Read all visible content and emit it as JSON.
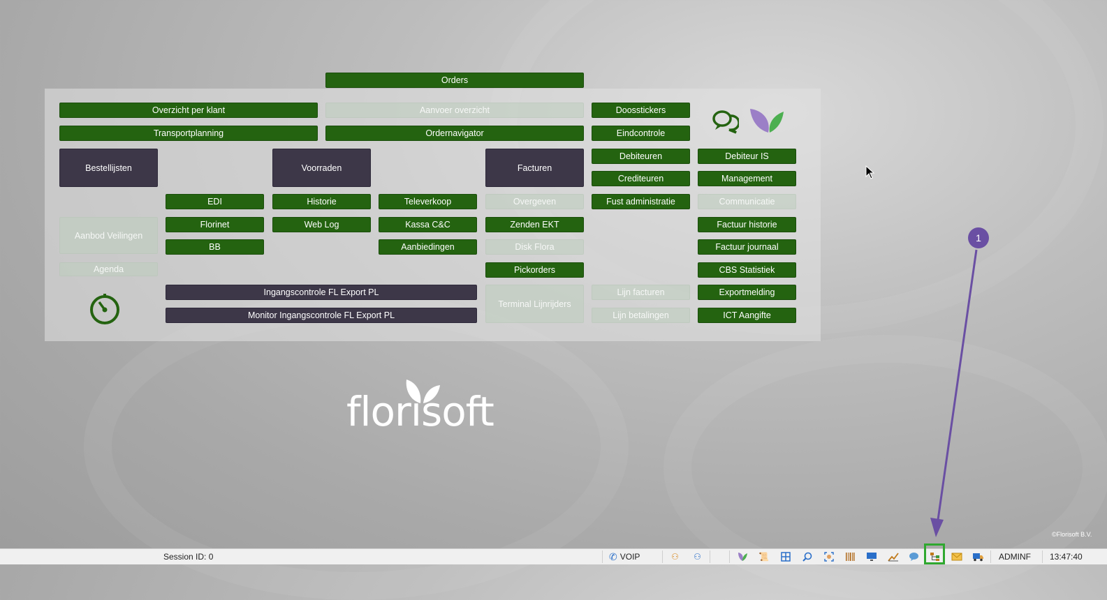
{
  "menu": {
    "orders": "Orders",
    "overzicht_per_klant": "Overzicht per klant",
    "aanvoer_overzicht": "Aanvoer overzicht",
    "doosstickers": "Doosstickers",
    "transportplanning": "Transportplanning",
    "ordernavigator": "Ordernavigator",
    "eindcontrole": "Eindcontrole",
    "bestellijsten": "Bestellijsten",
    "voorraden": "Voorraden",
    "facturen": "Facturen",
    "debiteuren": "Debiteuren",
    "debiteur_is": "Debiteur IS",
    "crediteuren": "Crediteuren",
    "management": "Management",
    "edi": "EDI",
    "historie": "Historie",
    "televerkoop": "Televerkoop",
    "overgeven": "Overgeven",
    "fust_administratie": "Fust administratie",
    "communicatie": "Communicatie",
    "aanbod_veilingen": "Aanbod Veilingen",
    "florinet": "Florinet",
    "web_log": "Web Log",
    "kassa_cc": "Kassa C&C",
    "zenden_ekt": "Zenden EKT",
    "factuur_historie": "Factuur historie",
    "bb": "BB",
    "aanbiedingen": "Aanbiedingen",
    "disk_flora": "Disk Flora",
    "factuur_journaal": "Factuur journaal",
    "agenda": "Agenda",
    "pickorders": "Pickorders",
    "cbs_statistiek": "CBS Statistiek",
    "ingangscontrole": "Ingangscontrole FL Export PL",
    "terminal_lijnrijders": "Terminal Lijnrijders",
    "lijn_facturen": "Lijn facturen",
    "exportmelding": "Exportmelding",
    "monitor_ingangscontrole": "Monitor Ingangscontrole FL Export PL",
    "lijn_betalingen": "Lijn betalingen",
    "ict_aangifte": "ICT Aangifte"
  },
  "logo": {
    "text": "florisoft"
  },
  "copyright": "©Florisoft B.V.",
  "annotation": {
    "number": "1",
    "color": "#6a4fa3"
  },
  "statusbar": {
    "session": "Session ID: 0",
    "voip": "VOIP",
    "user": "ADMINF",
    "time": "13:47:40"
  },
  "colors": {
    "button_green": "#246310",
    "button_dark": "#3d3748",
    "highlight": "#2fa82f",
    "annotation": "#6a4fa3"
  }
}
